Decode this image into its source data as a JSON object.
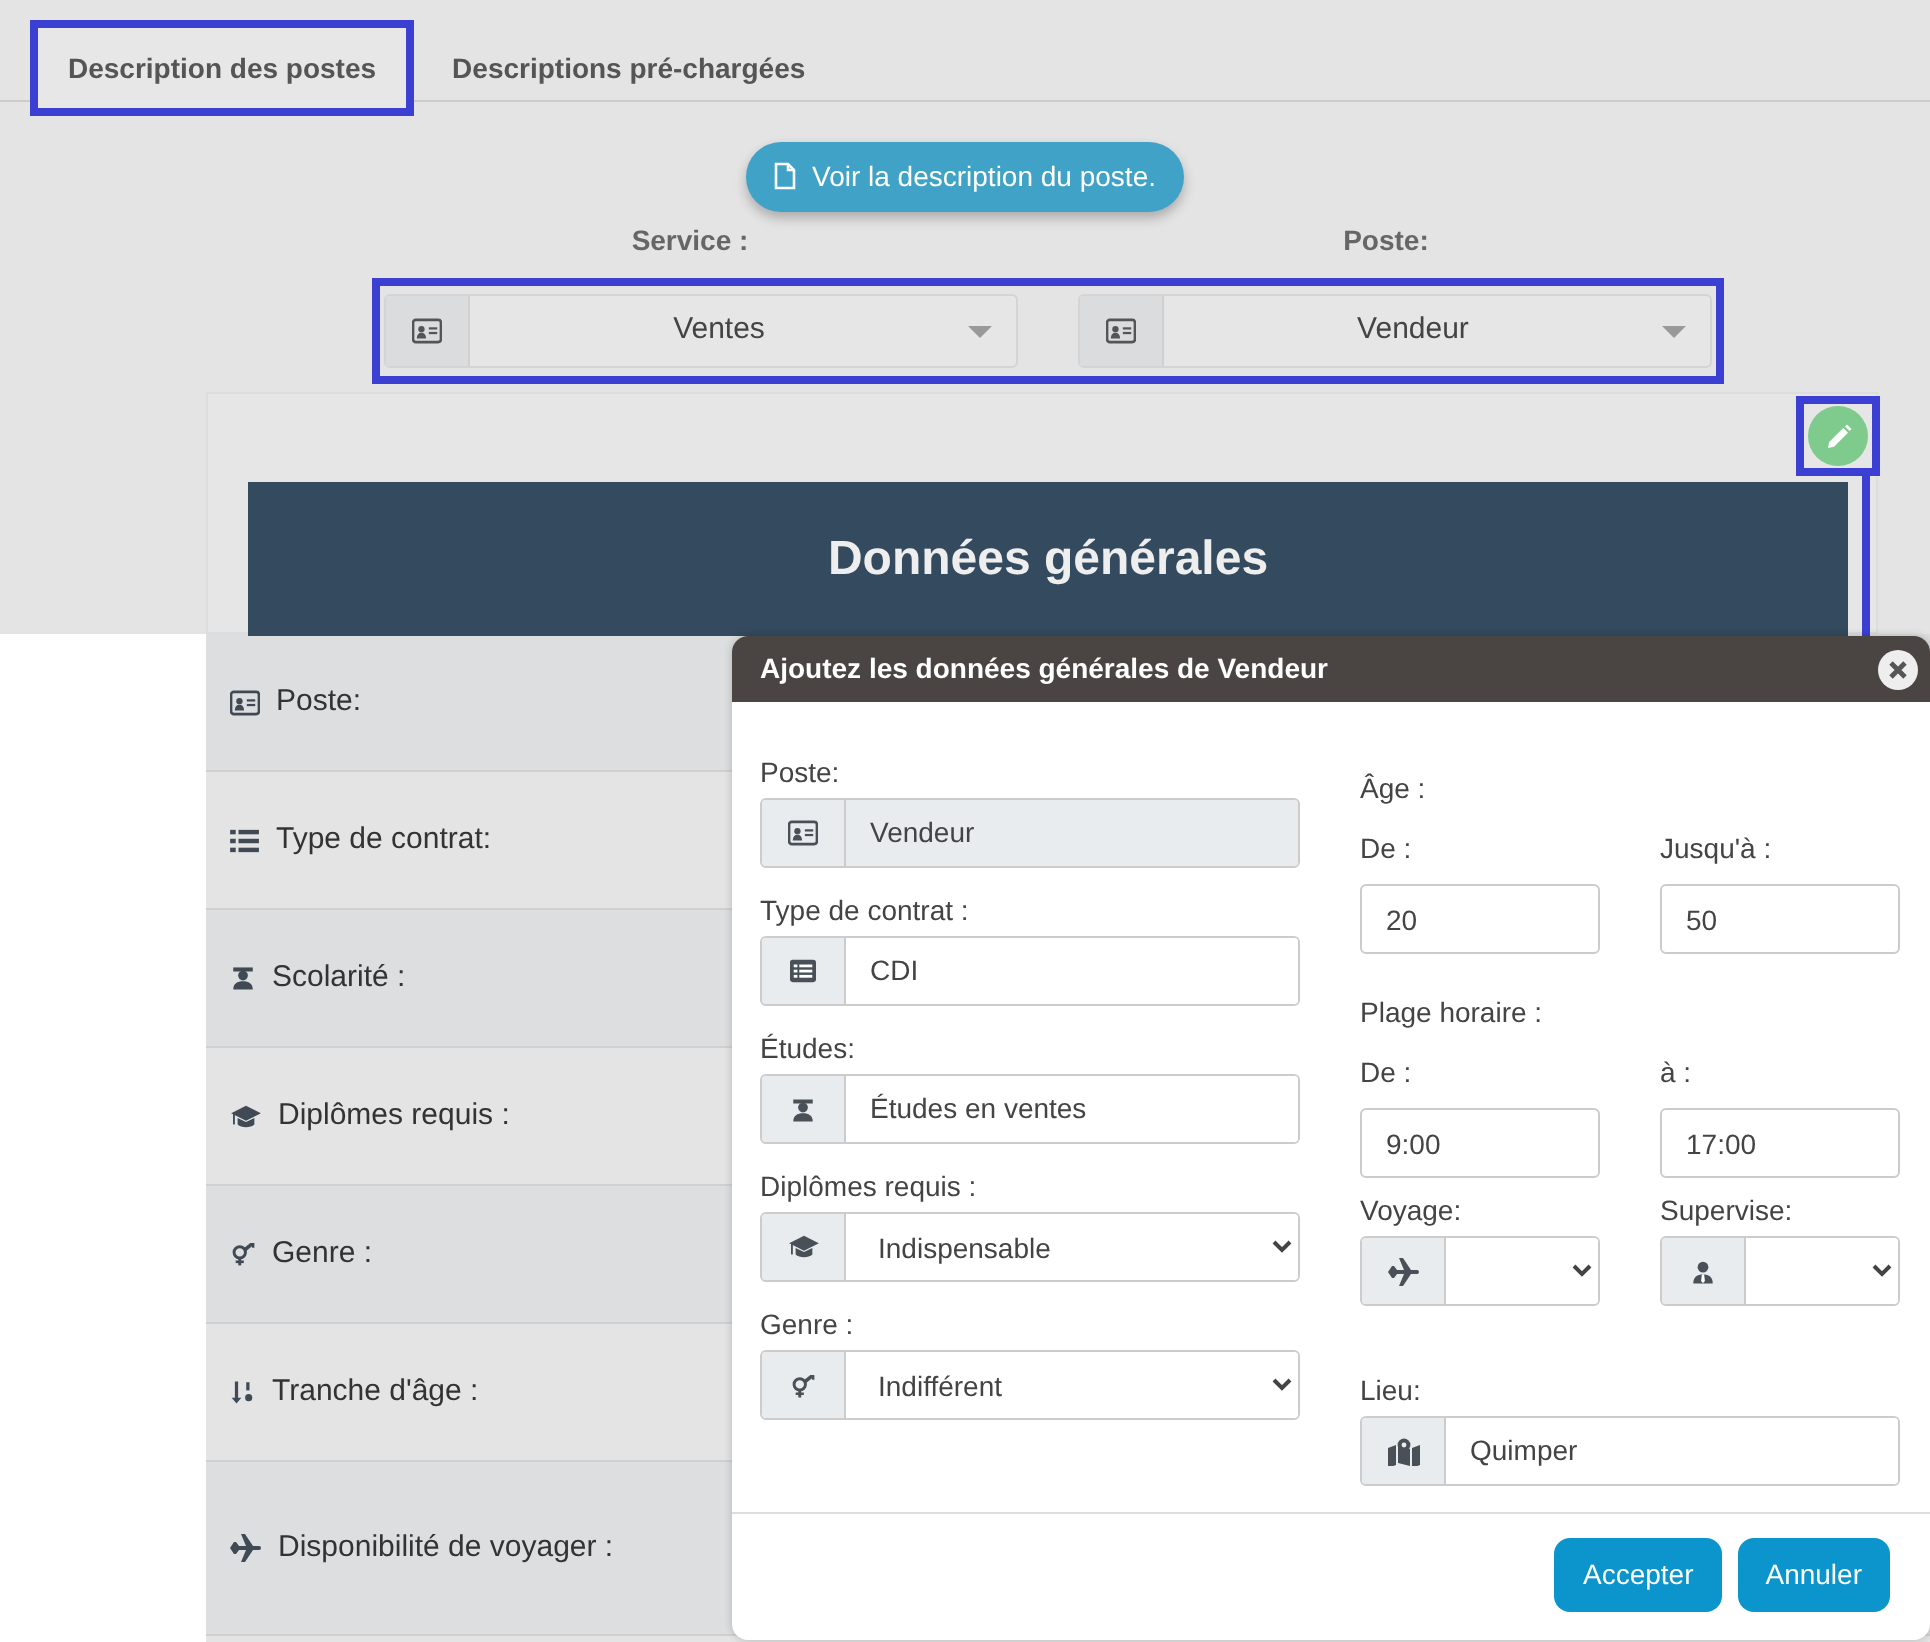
{
  "tabs": [
    {
      "label": "Description des postes",
      "selected": true,
      "highlighted": true
    },
    {
      "label": "Descriptions pré-chargées",
      "selected": false,
      "highlighted": false
    }
  ],
  "view_button": "Voir la description du poste.",
  "filters": {
    "highlighted": true,
    "items": [
      {
        "label": "Service :",
        "value": "Ventes"
      },
      {
        "label": "Poste:",
        "value": "Vendeur"
      }
    ]
  },
  "edit_button": {
    "highlighted": true
  },
  "section_title": "Données générales",
  "rows": [
    "Poste:",
    "Type de contrat:",
    "Scolarité :",
    "Diplômes requis :",
    "Genre :",
    "Tranche d'âge :",
    "Disponibilité de voyager :"
  ],
  "modal": {
    "title": "Ajoutez les données générales de Vendeur",
    "left_fields": [
      {
        "label": "Poste:",
        "kind": "text",
        "value": "Vendeur",
        "disabled": true
      },
      {
        "label": "Type de contrat :",
        "kind": "text",
        "value": "CDI",
        "disabled": false
      },
      {
        "label": "Études:",
        "kind": "text",
        "value": "Études en ventes",
        "disabled": false
      },
      {
        "label": "Diplômes requis :",
        "kind": "select",
        "value": "Indispensable",
        "disabled": false
      },
      {
        "label": "Genre :",
        "kind": "select",
        "value": "Indifférent",
        "disabled": false
      }
    ],
    "ranges": [
      {
        "label": "Âge :",
        "from_label": "De :",
        "from": "20",
        "to_label": "Jusqu'à :",
        "to": "50"
      },
      {
        "label": "Plage horaire :",
        "from_label": "De :",
        "from": "9:00",
        "to_label": "à :",
        "to": "17:00"
      }
    ],
    "selects": [
      {
        "label": "Voyage:"
      },
      {
        "label": "Supervise:"
      }
    ],
    "location": {
      "label": "Lieu:",
      "value": "Quimper"
    },
    "buttons": [
      "Accepter",
      "Annuler"
    ]
  }
}
